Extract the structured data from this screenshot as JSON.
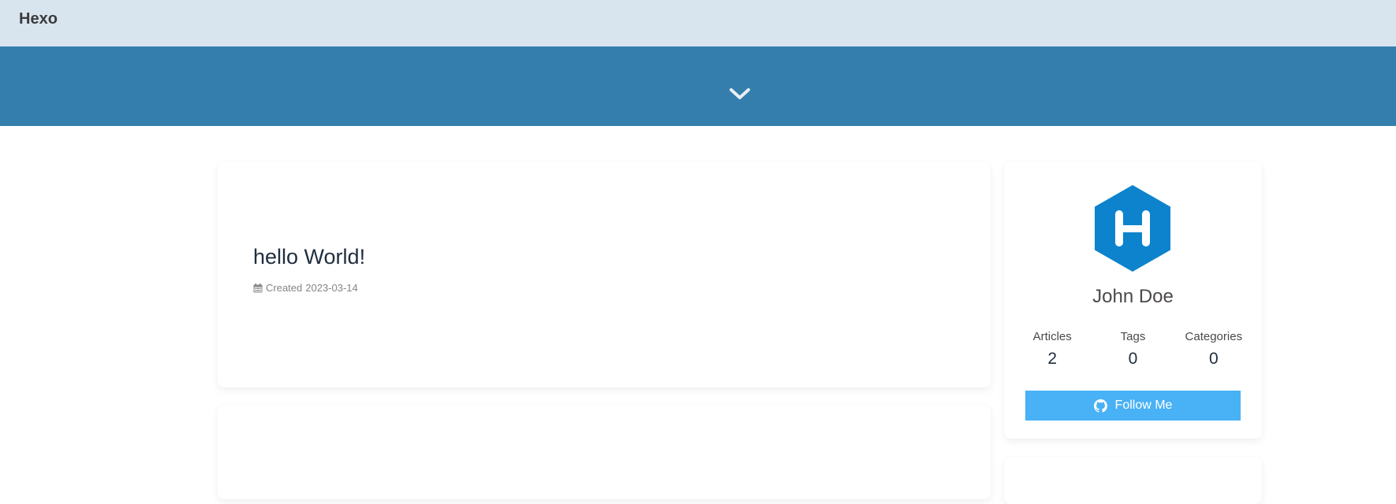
{
  "header": {
    "site_title": "Hexo"
  },
  "banner": {
    "icon": "chevron-down-icon"
  },
  "posts": [
    {
      "title": "hello World!",
      "meta_label": "Created",
      "date": "2023-03-14",
      "meta_icon": "calendar-icon"
    }
  ],
  "author": {
    "avatar_icon": "hexo-logo",
    "avatar_letter": "H",
    "name": "John Doe",
    "stats": [
      {
        "label": "Articles",
        "value": "2"
      },
      {
        "label": "Tags",
        "value": "0"
      },
      {
        "label": "Categories",
        "value": "0"
      }
    ],
    "follow_button": {
      "label": "Follow Me",
      "icon": "github-icon"
    }
  },
  "colors": {
    "topbar_bg": "#d8e5ef",
    "banner_bg": "#347ead",
    "button_bg": "#49b1f5",
    "avatar_bg": "#0e83cd"
  }
}
